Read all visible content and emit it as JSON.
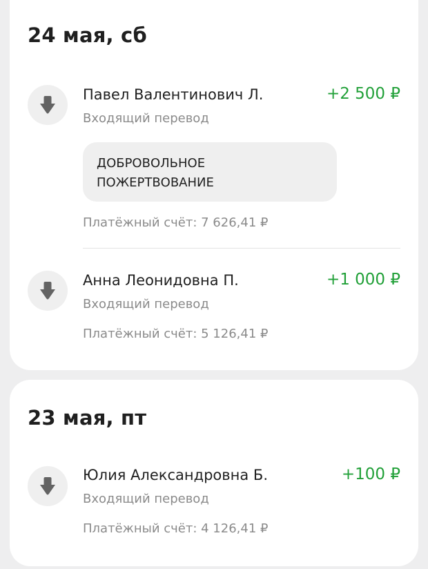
{
  "groups": [
    {
      "date": "24 мая, сб",
      "transactions": [
        {
          "name": "Павел Валентинович Л.",
          "type": "Входящий перевод",
          "amount": "+2 500 ₽",
          "message": "ДОБРОВОЛЬНОЕ ПОЖЕРТВОВАНИЕ",
          "balance": "Платёжный счёт: 7 626,41 ₽",
          "icon": "arrow-down-icon"
        },
        {
          "name": "Анна Леонидовна П.",
          "type": "Входящий перевод",
          "amount": "+1 000 ₽",
          "balance": "Платёжный счёт: 5 126,41 ₽",
          "icon": "arrow-down-icon"
        }
      ]
    },
    {
      "date": "23 мая, пт",
      "transactions": [
        {
          "name": "Юлия Александровна Б.",
          "type": "Входящий перевод",
          "amount": "+100 ₽",
          "balance": "Платёжный счёт: 4 126,41 ₽",
          "icon": "arrow-down-icon"
        }
      ]
    }
  ],
  "colors": {
    "amount_positive": "#21a038",
    "background": "#eeeeef",
    "card": "#ffffff",
    "secondary_text": "#8a8a8a",
    "icon_bg": "#efefef",
    "icon_fg": "#636363"
  }
}
